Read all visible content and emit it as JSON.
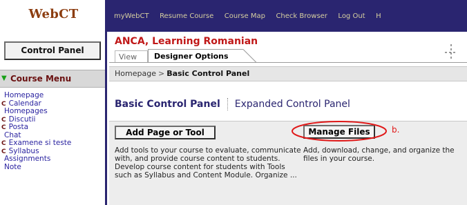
{
  "header": {
    "logo": "WebCT",
    "nav": [
      "myWebCT",
      "Resume Course",
      "Course Map",
      "Check Browser",
      "Log Out",
      "H"
    ]
  },
  "sidebar": {
    "control_panel_label": "Control Panel",
    "course_menu_label": "Course Menu",
    "items": [
      {
        "label": "Homepage",
        "bullet": ""
      },
      {
        "label": "Calendar",
        "bullet": "C"
      },
      {
        "label": "Homepages",
        "bullet": ""
      },
      {
        "label": "Discutii",
        "bullet": "C"
      },
      {
        "label": "Posta",
        "bullet": "C"
      },
      {
        "label": "Chat",
        "bullet": ""
      },
      {
        "label": "Examene si teste",
        "bullet": "C"
      },
      {
        "label": "Syllabus",
        "bullet": "C"
      },
      {
        "label": "Assignments",
        "bullet": ""
      },
      {
        "label": "Note",
        "bullet": ""
      }
    ]
  },
  "main": {
    "course_title": "ANCA, Learning Romanian",
    "tabs": {
      "view": "View",
      "designer": "Designer Options"
    },
    "breadcrumb": {
      "home": "Homepage",
      "separator": ">",
      "current": "Basic Control Panel"
    },
    "panel_tabs": {
      "basic": "Basic Control Panel",
      "expanded": "Expanded Control Panel"
    },
    "tools": {
      "add_page": {
        "label": "Add Page or Tool",
        "description": "Add tools to your course to evaluate, communicate with, and provide course content to students. Develop course content for students with Tools such as Syllabus and Content Module. Organize ..."
      },
      "manage_files": {
        "label": "Manage Files",
        "description": "Add, download, change, and organize the files in your course."
      }
    },
    "annotation": "b."
  },
  "colors": {
    "topbar": "#2a2570",
    "logo": "#8c3d10",
    "nav_text": "#d6cfa0",
    "course_title": "#c01818",
    "annotation_red": "#e01818",
    "menu_link": "#2a23a0"
  }
}
